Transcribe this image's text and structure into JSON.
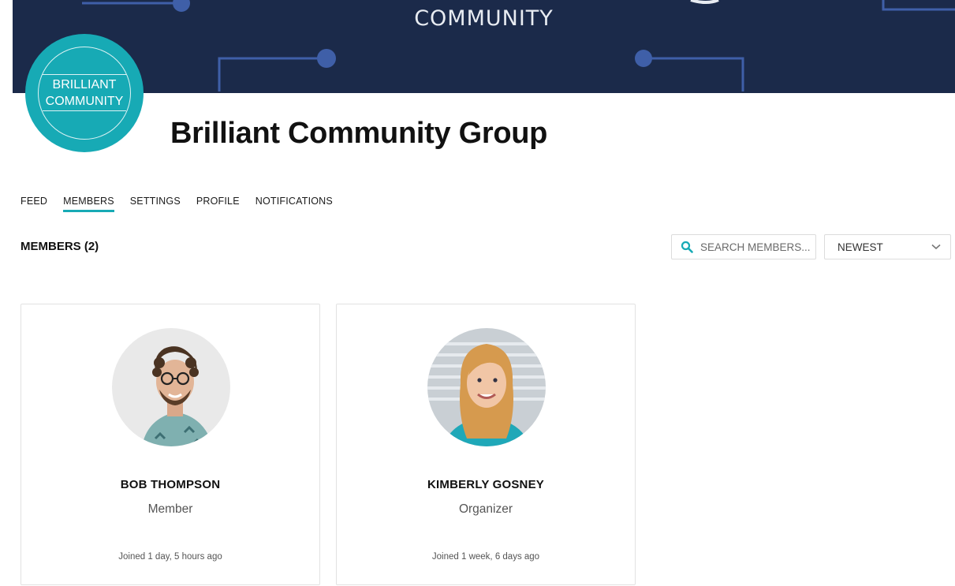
{
  "banner": {
    "text": "COMMUNITY"
  },
  "logo": {
    "line1": "BRILLIANT",
    "line2": "COMMUNITY"
  },
  "group": {
    "title": "Brilliant Community Group"
  },
  "tabs": [
    {
      "label": "FEED"
    },
    {
      "label": "MEMBERS",
      "active": true
    },
    {
      "label": "SETTINGS"
    },
    {
      "label": "PROFILE"
    },
    {
      "label": "NOTIFICATIONS"
    }
  ],
  "members": {
    "heading": "MEMBERS (2)",
    "search_placeholder": "SEARCH MEMBERS...",
    "sort_value": "NEWEST",
    "cards": [
      {
        "name": "BOB THOMPSON",
        "role": "Member",
        "joined": "Joined 1 day, 5 hours ago"
      },
      {
        "name": "KIMBERLY GOSNEY",
        "role": "Organizer",
        "joined": "Joined 1 week, 6 days ago"
      }
    ]
  },
  "colors": {
    "accent": "#17aab5",
    "banner_bg": "#1b2a4a",
    "banner_line": "#3f5fa8"
  }
}
